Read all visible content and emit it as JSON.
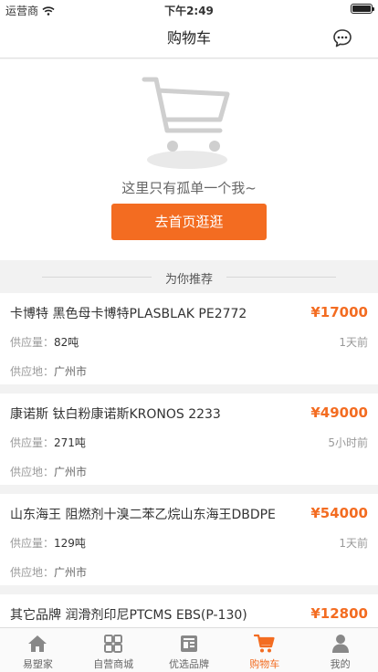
{
  "status_bar": {
    "carrier": "运营商",
    "time": "下午2:49"
  },
  "nav": {
    "title": "购物车"
  },
  "empty_state": {
    "message": "这里只有孤单一个我~",
    "button_label": "去首页逛逛"
  },
  "recommend": {
    "title": "为你推荐",
    "supply_label": "供应量：",
    "origin_label": "供应地：",
    "items": [
      {
        "name": "卡博特 黑色母卡博特PLASBLAK PE2772",
        "price": "¥17000",
        "supply": "82吨",
        "time": "1天前",
        "origin": "广州市"
      },
      {
        "name": "康诺斯 钛白粉康诺斯KRONOS 2233",
        "price": "¥49000",
        "supply": "271吨",
        "time": "5小时前",
        "origin": "广州市"
      },
      {
        "name": "山东海王 阻燃剂十溴二苯乙烷山东海王DBDPE",
        "price": "¥54000",
        "supply": "129吨",
        "time": "1天前",
        "origin": "广州市"
      },
      {
        "name": "其它品牌 润滑剂印尼PTCMS EBS(P-130)",
        "price": "¥12800",
        "supply": "",
        "time": "",
        "origin": ""
      }
    ]
  },
  "tab_bar": {
    "tabs": [
      {
        "label": "易塑家",
        "icon": "home-icon"
      },
      {
        "label": "自营商城",
        "icon": "grid-icon"
      },
      {
        "label": "优选品牌",
        "icon": "brand-icon"
      },
      {
        "label": "购物车",
        "icon": "cart-icon",
        "active": true
      },
      {
        "label": "我的",
        "icon": "person-icon"
      }
    ]
  },
  "colors": {
    "accent": "#f36c21",
    "background": "#f2f2f2"
  }
}
